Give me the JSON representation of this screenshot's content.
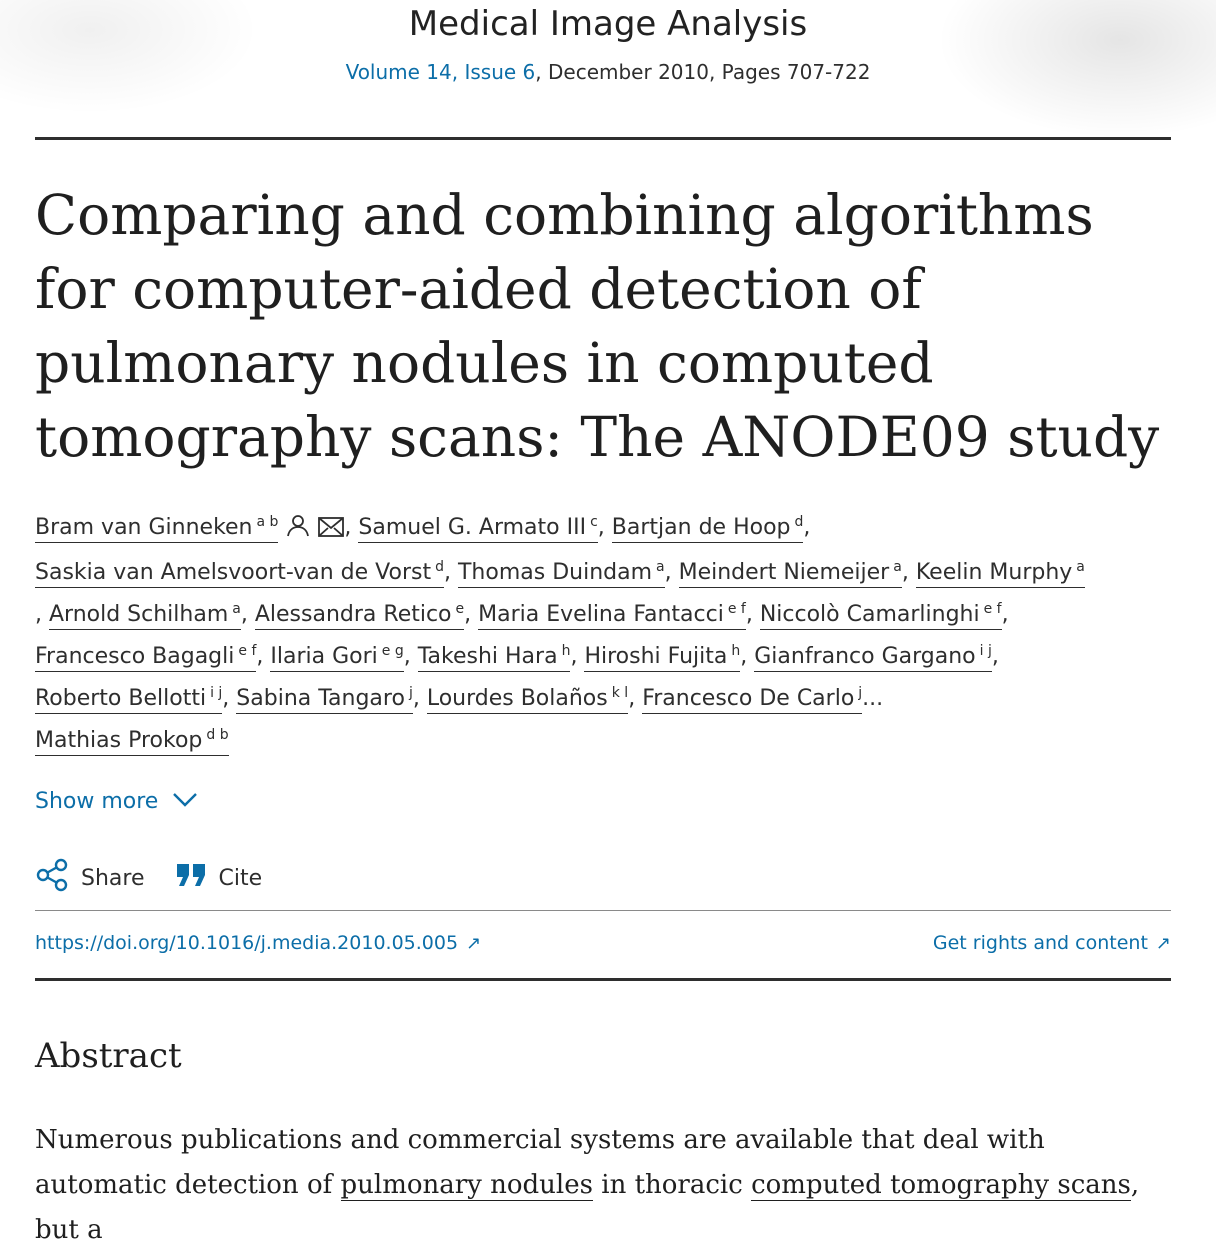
{
  "journal": {
    "name": "Medical Image Analysis",
    "volume_issue": "Volume 14, Issue 6",
    "details": ", December 2010, Pages 707-722"
  },
  "article": {
    "title": "Comparing and combining algorithms for computer-aided detection of pulmonary nodules in computed tomography scans: The ANODE09 study",
    "authors": [
      {
        "name": "Bram van Ginneken",
        "sup": "a b"
      },
      {
        "name": "Samuel G. Armato III",
        "sup": "c"
      },
      {
        "name": "Bartjan de Hoop",
        "sup": "d"
      },
      {
        "name": "Saskia van Amelsvoort-van de Vorst",
        "sup": "d"
      },
      {
        "name": "Thomas Duindam",
        "sup": "a"
      },
      {
        "name": "Meindert Niemeijer",
        "sup": "a"
      },
      {
        "name": "Keelin Murphy",
        "sup": "a"
      },
      {
        "name": "Arnold Schilham",
        "sup": "a"
      },
      {
        "name": "Alessandra Retico",
        "sup": "e"
      },
      {
        "name": "Maria Evelina Fantacci",
        "sup": "e f"
      },
      {
        "name": "Niccolò Camarlinghi",
        "sup": "e f"
      },
      {
        "name": "Francesco Bagagli",
        "sup": "e f"
      },
      {
        "name": "Ilaria Gori",
        "sup": "e g"
      },
      {
        "name": "Takeshi Hara",
        "sup": "h"
      },
      {
        "name": "Hiroshi Fujita",
        "sup": "h"
      },
      {
        "name": "Gianfranco Gargano",
        "sup": "i j"
      },
      {
        "name": "Roberto Bellotti",
        "sup": "i j"
      },
      {
        "name": "Sabina Tangaro",
        "sup": "j"
      },
      {
        "name": "Lourdes Bolaños",
        "sup": "k l"
      },
      {
        "name": "Francesco De Carlo",
        "sup": "j"
      },
      {
        "name": "Mathias Prokop",
        "sup": "d b"
      }
    ],
    "ellipsis": "...",
    "show_more": "Show more",
    "share": "Share",
    "cite": "Cite",
    "doi": "https://doi.org/10.1016/j.media.2010.05.005",
    "rights": "Get rights and content"
  },
  "abstract": {
    "heading": "Abstract",
    "text_1": "Numerous publications and commercial systems are available that deal with automatic detection of ",
    "link_1": "pulmonary nodules",
    "text_2": " in thoracic ",
    "link_2": "computed tomography scans",
    "text_3": ", but a"
  },
  "colors": {
    "link": "#0c6ea8",
    "text": "#1f1f1f"
  },
  "icons": [
    "person-icon",
    "envelope-icon",
    "chevron-down-icon",
    "share-icon",
    "quote-icon",
    "external-link-icon"
  ]
}
